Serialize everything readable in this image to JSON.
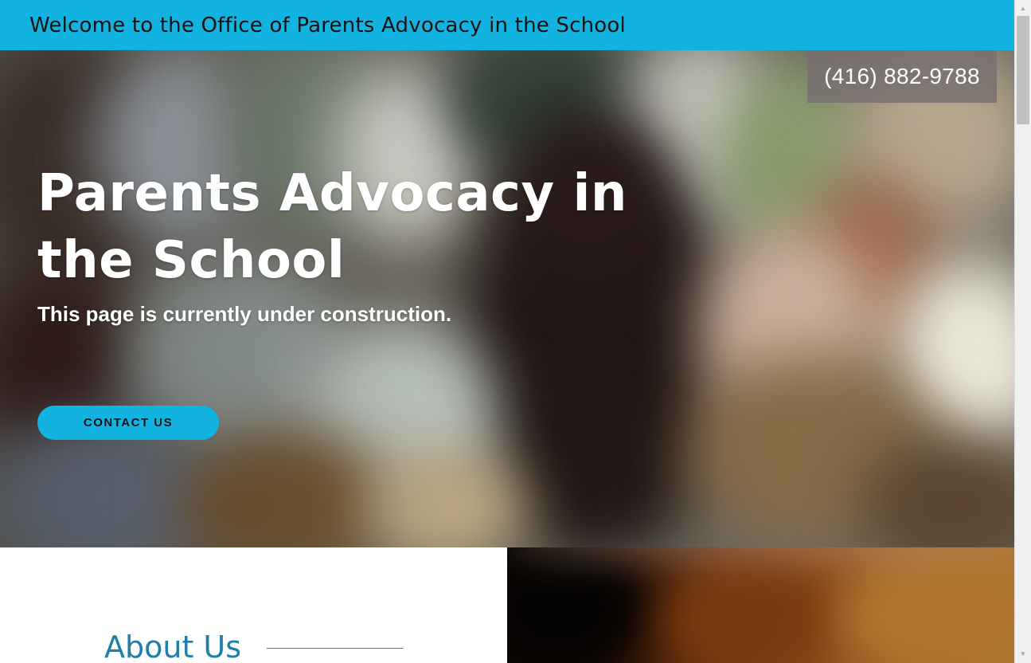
{
  "header": {
    "title": "Welcome to the Office of Parents Advocacy in the School"
  },
  "hero": {
    "phone": "(416) 882-9788",
    "heading": "Parents Advocacy in the School",
    "subtitle": "This page is currently under construction.",
    "cta_label": "CONTACT US"
  },
  "about": {
    "heading": "About Us"
  },
  "colors": {
    "accent": "#12b3e0",
    "heading_blue": "#1e7fa8",
    "phone_box": "#787070"
  },
  "icons": {
    "scroll_up": "chevron-up-icon",
    "scroll_down": "chevron-down-icon"
  }
}
